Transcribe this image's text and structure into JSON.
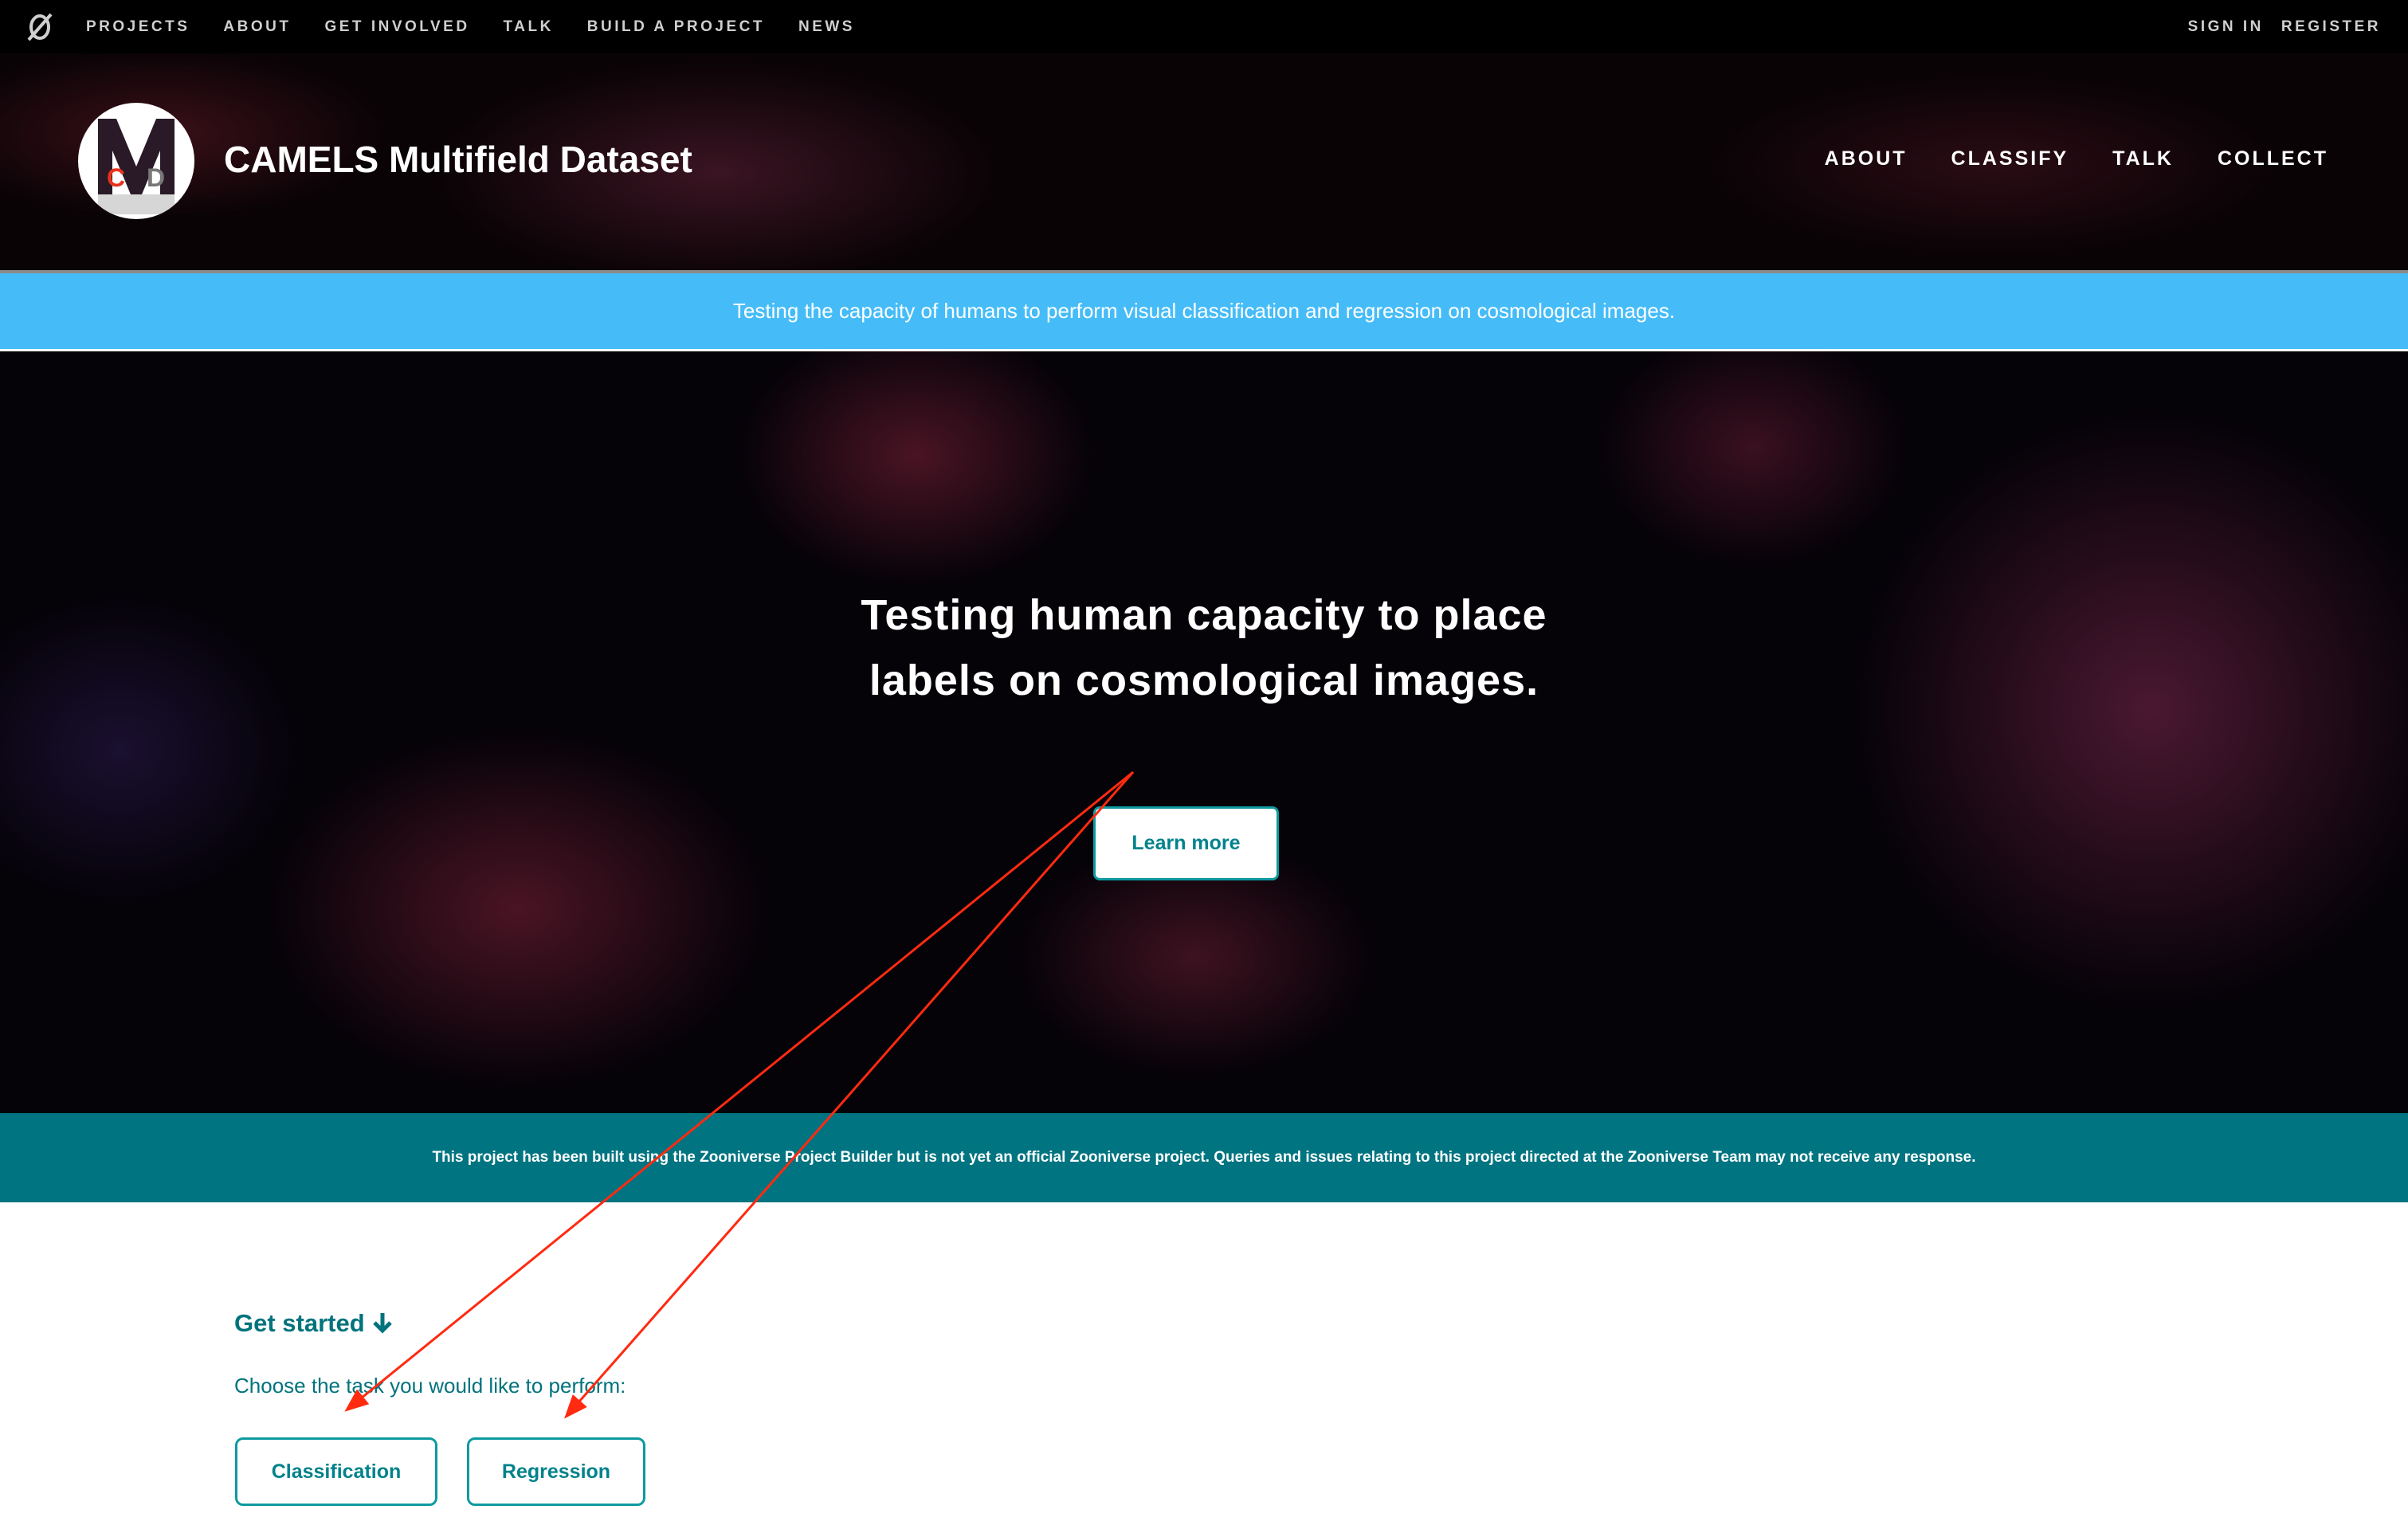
{
  "topbar": {
    "logo_icon": "zooniverse-logo-icon",
    "nav": [
      "PROJECTS",
      "ABOUT",
      "GET INVOLVED",
      "TALK",
      "BUILD A PROJECT",
      "NEWS"
    ],
    "sign_in": "SIGN IN",
    "register": "REGISTER"
  },
  "project": {
    "title": "CAMELS Multifield Dataset",
    "logo_letters": "MCDX",
    "nav": [
      "ABOUT",
      "CLASSIFY",
      "TALK",
      "COLLECT"
    ]
  },
  "banner": {
    "text": "Testing the capacity of humans to perform visual classification and regression on cosmological images.",
    "color": "#45bcf8"
  },
  "hero": {
    "title_line1": "Testing human capacity to place",
    "title_line2": "labels on cosmological images.",
    "learn_more": "Learn more"
  },
  "notice": {
    "text": "This project has been built using the Zooniverse Project Builder but is not yet an official Zooniverse project. Queries and issues relating to this project directed at the Zooniverse Team may not receive any response.",
    "color": "#007480"
  },
  "get_started": {
    "heading": "Get started",
    "icon": "arrow-down-icon",
    "prompt": "Choose the task you would like to perform:",
    "buttons": [
      "Classification",
      "Regression"
    ]
  },
  "annotation": {
    "arrow_color": "#ff2a10"
  }
}
